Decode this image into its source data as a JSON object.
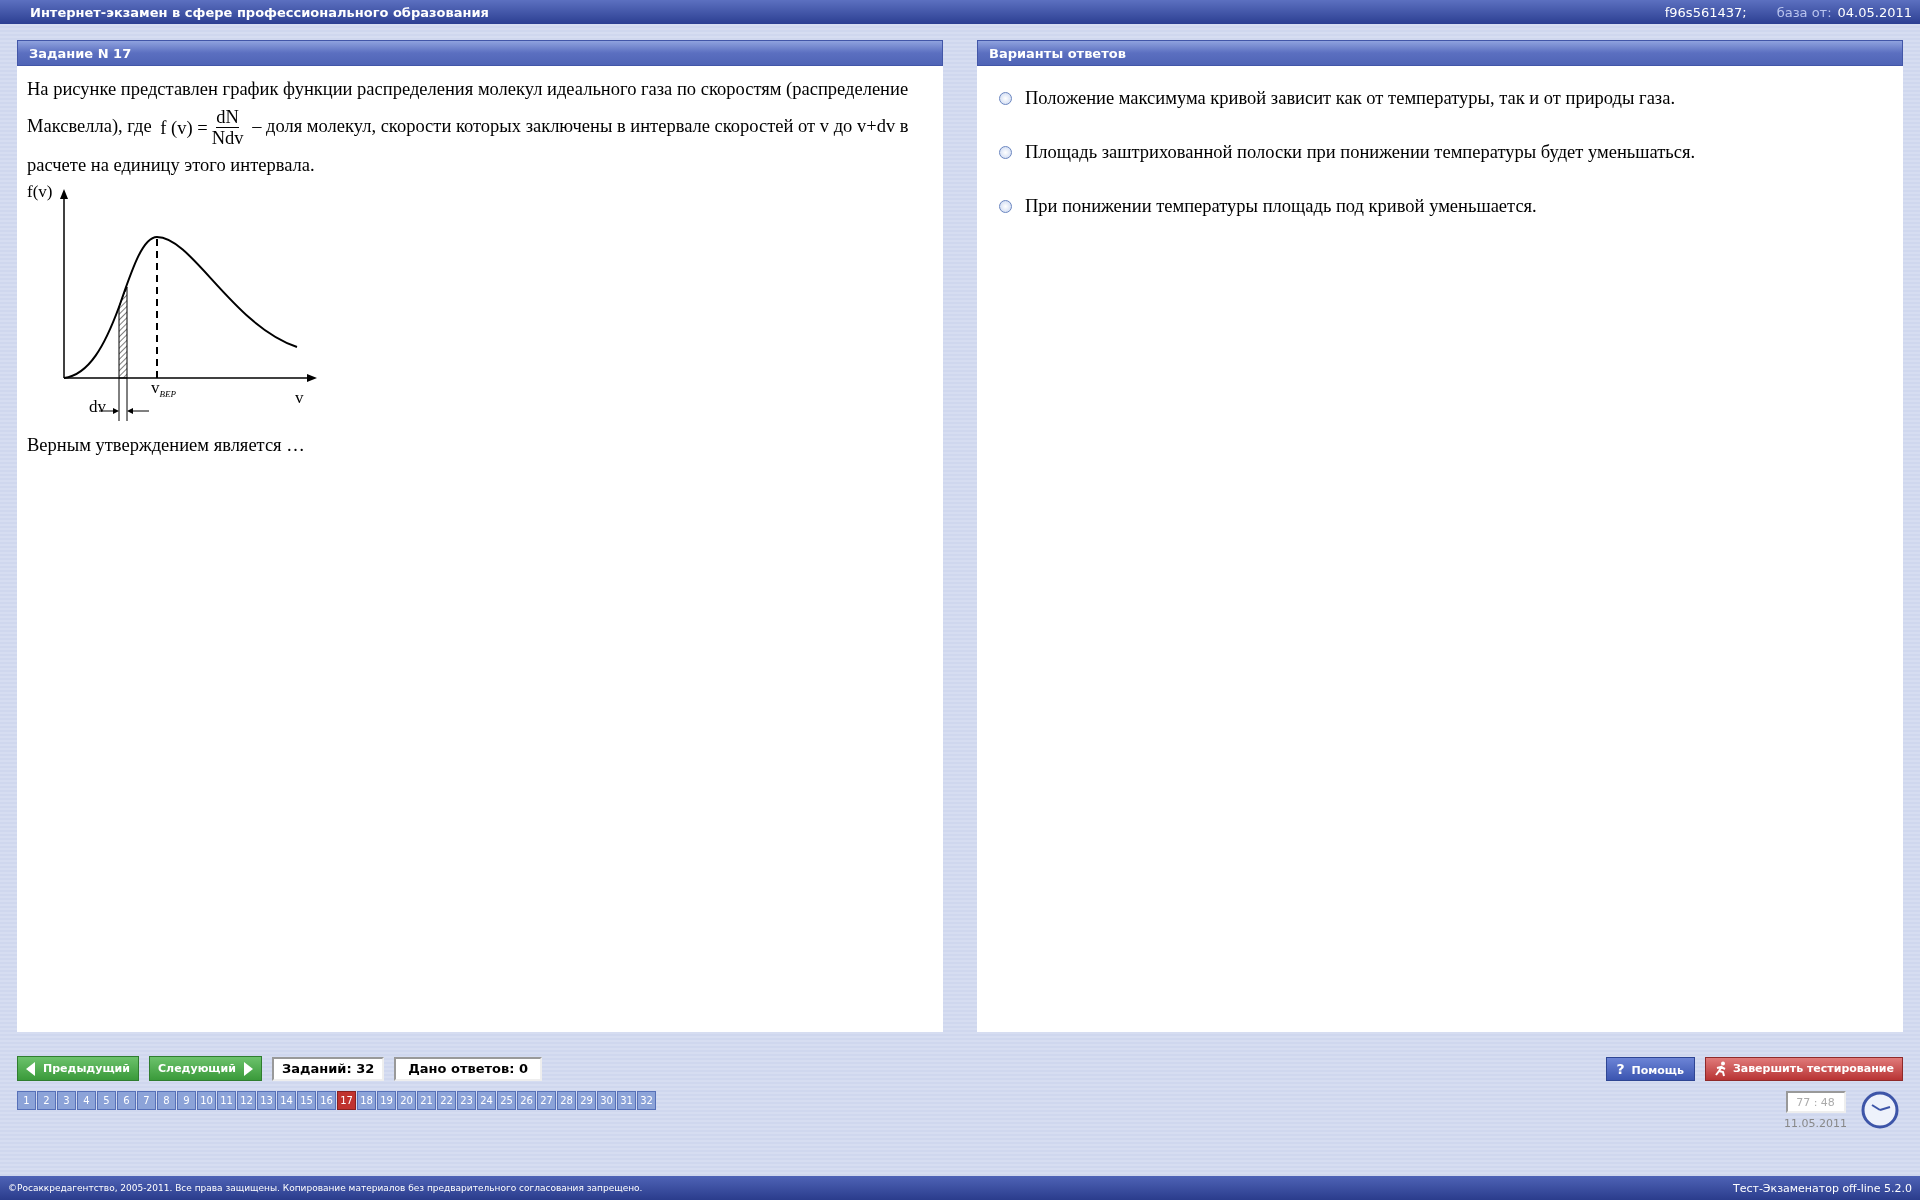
{
  "title_bar": {
    "title": "Интернет-экзамен в сфере профессионального образования",
    "code": "f96s561437;",
    "base_label": "база от:",
    "base_date": "04.05.2011"
  },
  "question": {
    "header": "Задание N 17",
    "text_before": "На рисунке представлен график функции распределения молекул идеального газа по скоростям (распределение Максвелла), где",
    "formula_left": "f (v) =",
    "numerator": "dN",
    "denominator": "Ndv",
    "text_after": "– доля молекул, скорости которых заключены в интервале скоростей от v до v+dv в расчете на единицу этого интервала.",
    "figure": {
      "y_label": "f(v)",
      "x_label": "v",
      "peak_label": "v$_{ВЕР}$",
      "interval_label": "dv"
    },
    "prompt": "Верным утверждением является …"
  },
  "answers": {
    "header": "Варианты ответов",
    "options": [
      {
        "text": "Положение максимума кривой зависит как от температуры, так и от природы газа.",
        "selected": false
      },
      {
        "text": "Площадь заштрихованной полоски при понижении температуры будет уменьшаться.",
        "selected": false
      },
      {
        "text": "При понижении температуры площадь под кривой уменьшается.",
        "selected": false
      }
    ]
  },
  "navigation": {
    "prev": "Предыдущий",
    "next": "Следующий",
    "total": "Заданий: 32",
    "answered": "Дано ответов: 0",
    "help_icon": "?",
    "help": "Помощь",
    "finish": "Завершить тестирование",
    "pages": [
      {
        "label": "1",
        "selected": false
      },
      {
        "label": "2",
        "selected": false
      },
      {
        "label": "3",
        "selected": false
      },
      {
        "label": "4",
        "selected": false
      },
      {
        "label": "5",
        "selected": false
      },
      {
        "label": "6",
        "selected": false
      },
      {
        "label": "7",
        "selected": false
      },
      {
        "label": "8",
        "selected": false
      },
      {
        "label": "9",
        "selected": false
      },
      {
        "label": "10",
        "selected": false
      },
      {
        "label": "11",
        "selected": false
      },
      {
        "label": "12",
        "selected": false
      },
      {
        "label": "13",
        "selected": false
      },
      {
        "label": "14",
        "selected": false
      },
      {
        "label": "15",
        "selected": false
      },
      {
        "label": "16",
        "selected": false
      },
      {
        "label": "17",
        "selected": true
      },
      {
        "label": "18",
        "selected": false
      },
      {
        "label": "19",
        "selected": false
      },
      {
        "label": "20",
        "selected": false
      },
      {
        "label": "21",
        "selected": false
      },
      {
        "label": "22",
        "selected": false
      },
      {
        "label": "23",
        "selected": false
      },
      {
        "label": "24",
        "selected": false
      },
      {
        "label": "25",
        "selected": false
      },
      {
        "label": "26",
        "selected": false
      },
      {
        "label": "27",
        "selected": false
      },
      {
        "label": "28",
        "selected": false
      },
      {
        "label": "29",
        "selected": false
      },
      {
        "label": "30",
        "selected": false
      },
      {
        "label": "31",
        "selected": false
      },
      {
        "label": "32",
        "selected": false
      }
    ],
    "timer": "77 : 48",
    "date": "11.05.2011"
  },
  "footer": {
    "copyright": "©Росаккредагентство, 2005-2011. Все права защищены. Копирование материалов без предварительного согласования запрещено.",
    "version": "Тест-Экзаменатор off-line 5.2.0"
  }
}
